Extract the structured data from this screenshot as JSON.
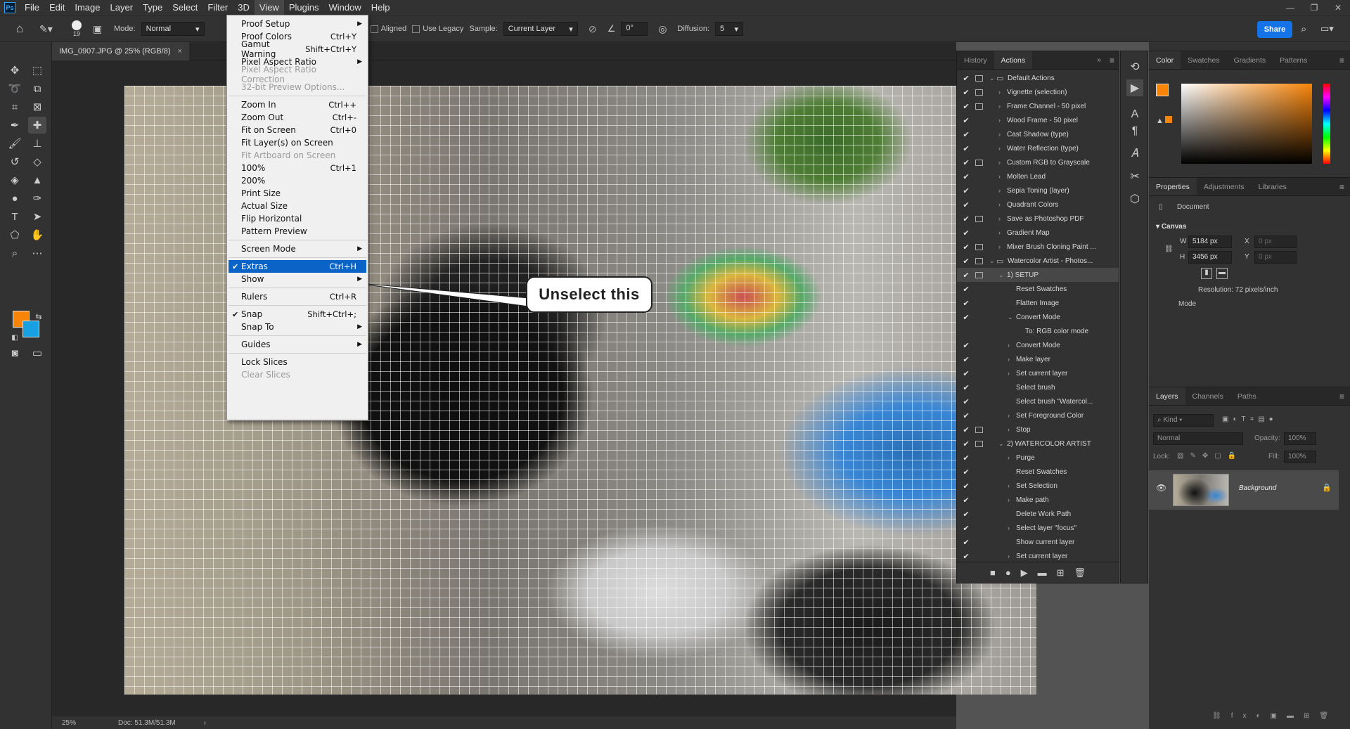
{
  "app": {
    "logo": "Ps"
  },
  "menubar": [
    "File",
    "Edit",
    "Image",
    "Layer",
    "Type",
    "Select",
    "Filter",
    "3D",
    "View",
    "Plugins",
    "Window",
    "Help"
  ],
  "options": {
    "brush_size": "19",
    "mode_label": "Mode:",
    "mode_value": "Normal",
    "aligned": "Aligned",
    "use_legacy": "Use Legacy",
    "sample_label": "Sample:",
    "sample_value": "Current Layer",
    "angle": "0°",
    "diffusion_label": "Diffusion:",
    "diffusion_value": "5",
    "share": "Share"
  },
  "document": {
    "tab_title": "IMG_0907.JPG @ 25% (RGB/8)",
    "close": "×"
  },
  "status": {
    "zoom": "25%",
    "doc": "Doc: 51.3M/51.3M"
  },
  "callout": "Unselect this",
  "view_menu": [
    {
      "label": "Proof Setup",
      "shortcut": "",
      "arrow": true
    },
    {
      "label": "Proof Colors",
      "shortcut": "Ctrl+Y"
    },
    {
      "label": "Gamut Warning",
      "shortcut": "Shift+Ctrl+Y"
    },
    {
      "label": "Pixel Aspect Ratio",
      "shortcut": "",
      "arrow": true
    },
    {
      "label": "Pixel Aspect Ratio Correction",
      "shortcut": "",
      "disabled": true
    },
    {
      "label": "32-bit Preview Options...",
      "shortcut": "",
      "disabled": true
    },
    {
      "sep": true
    },
    {
      "label": "Zoom In",
      "shortcut": "Ctrl++"
    },
    {
      "label": "Zoom Out",
      "shortcut": "Ctrl+-"
    },
    {
      "label": "Fit on Screen",
      "shortcut": "Ctrl+0"
    },
    {
      "label": "Fit Layer(s) on Screen",
      "shortcut": ""
    },
    {
      "label": "Fit Artboard on Screen",
      "shortcut": "",
      "disabled": true
    },
    {
      "label": "100%",
      "shortcut": "Ctrl+1"
    },
    {
      "label": "200%",
      "shortcut": ""
    },
    {
      "label": "Print Size",
      "shortcut": ""
    },
    {
      "label": "Actual Size",
      "shortcut": ""
    },
    {
      "label": "Flip Horizontal",
      "shortcut": ""
    },
    {
      "label": "Pattern Preview",
      "shortcut": ""
    },
    {
      "sep": true
    },
    {
      "label": "Screen Mode",
      "shortcut": "",
      "arrow": true
    },
    {
      "sep": true
    },
    {
      "label": "Extras",
      "shortcut": "Ctrl+H",
      "checked": true,
      "highlight": true
    },
    {
      "label": "Show",
      "shortcut": "",
      "arrow": true
    },
    {
      "sep": true
    },
    {
      "label": "Rulers",
      "shortcut": "Ctrl+R"
    },
    {
      "sep": true
    },
    {
      "label": "Snap",
      "shortcut": "Shift+Ctrl+;",
      "checked": true
    },
    {
      "label": "Snap To",
      "shortcut": "",
      "arrow": true
    },
    {
      "sep": true
    },
    {
      "label": "Guides",
      "shortcut": "",
      "arrow": true
    },
    {
      "sep": true
    },
    {
      "label": "Lock Slices",
      "shortcut": ""
    },
    {
      "label": "Clear Slices",
      "shortcut": "",
      "disabled": true
    }
  ],
  "actions_panel": {
    "tabs": [
      "History",
      "Actions"
    ],
    "rows": [
      {
        "name": "Default Actions",
        "level": 0,
        "folder": true,
        "open": true,
        "dlg": true
      },
      {
        "name": "Vignette (selection)",
        "level": 1,
        "dlg": true
      },
      {
        "name": "Frame Channel - 50 pixel",
        "level": 1,
        "dlg": true
      },
      {
        "name": "Wood Frame - 50 pixel",
        "level": 1,
        "dlg": false
      },
      {
        "name": "Cast Shadow (type)",
        "level": 1,
        "dlg": false
      },
      {
        "name": "Water Reflection (type)",
        "level": 1,
        "dlg": false
      },
      {
        "name": "Custom RGB to Grayscale",
        "level": 1,
        "dlg": true
      },
      {
        "name": "Molten Lead",
        "level": 1,
        "dlg": false
      },
      {
        "name": "Sepia Toning (layer)",
        "level": 1,
        "dlg": false
      },
      {
        "name": "Quadrant Colors",
        "level": 1,
        "dlg": false
      },
      {
        "name": "Save as Photoshop PDF",
        "level": 1,
        "dlg": true
      },
      {
        "name": "Gradient Map",
        "level": 1,
        "dlg": false
      },
      {
        "name": "Mixer Brush Cloning Paint ...",
        "level": 1,
        "dlg": true
      },
      {
        "name": "Watercolor Artist - Photos...",
        "level": 0,
        "folder": true,
        "open": true,
        "dlg": true
      },
      {
        "name": "1) SETUP",
        "level": 1,
        "open": true,
        "dlg": true,
        "selected": true
      },
      {
        "name": "Reset Swatches",
        "level": 2,
        "dlg": false
      },
      {
        "name": "Flatten Image",
        "level": 2,
        "dlg": false
      },
      {
        "name": "Convert Mode",
        "level": 2,
        "open": true,
        "dlg": false
      },
      {
        "name": "To: RGB color mode",
        "level": 3,
        "nocheck": true
      },
      {
        "name": "Convert Mode",
        "level": 2,
        "closed": true,
        "dlg": false
      },
      {
        "name": "Make layer",
        "level": 2,
        "closed": true,
        "dlg": false
      },
      {
        "name": "Set current layer",
        "level": 2,
        "closed": true,
        "dlg": false
      },
      {
        "name": "Select brush",
        "level": 2,
        "dlg": false
      },
      {
        "name": "Select brush \"Watercol...",
        "level": 2,
        "dlg": false
      },
      {
        "name": "Set Foreground Color",
        "level": 2,
        "closed": true,
        "dlg": false
      },
      {
        "name": "Stop",
        "level": 2,
        "closed": true,
        "dlg": true
      },
      {
        "name": "2) WATERCOLOR ARTIST",
        "level": 1,
        "open": true,
        "dlg": true
      },
      {
        "name": "Purge",
        "level": 2,
        "closed": true,
        "dlg": false
      },
      {
        "name": "Reset Swatches",
        "level": 2,
        "dlg": false
      },
      {
        "name": "Set Selection",
        "level": 2,
        "closed": true,
        "dlg": false
      },
      {
        "name": "Make path",
        "level": 2,
        "closed": true,
        "dlg": false
      },
      {
        "name": "Delete Work Path",
        "level": 2,
        "dlg": false
      },
      {
        "name": "Select layer \"focus\"",
        "level": 2,
        "closed": true,
        "dlg": false
      },
      {
        "name": "Show current layer",
        "level": 2,
        "dlg": false
      },
      {
        "name": "Set current layer",
        "level": 2,
        "closed": true,
        "dlg": false
      }
    ]
  },
  "color_panel": {
    "tabs": [
      "Color",
      "Swatches",
      "Gradients",
      "Patterns"
    ],
    "foreground": "#f88408",
    "background": "#18a0e3"
  },
  "properties": {
    "tabs": [
      "Properties",
      "Adjustments",
      "Libraries"
    ],
    "type": "Document",
    "section": "Canvas",
    "w_label": "W",
    "w": "5184 px",
    "h_label": "H",
    "h": "3456 px",
    "x_label": "X",
    "x": "0 px",
    "y_label": "Y",
    "y": "0 px",
    "resolution": "Resolution: 72 pixels/inch",
    "mode": "Mode"
  },
  "layers": {
    "tabs": [
      "Layers",
      "Channels",
      "Paths"
    ],
    "kind": "Kind",
    "blend": "Normal",
    "opacity_label": "Opacity:",
    "opacity": "100%",
    "lock_label": "Lock:",
    "fill_label": "Fill:",
    "fill": "100%",
    "layer_name": "Background"
  },
  "colors": {
    "accent": "#1473e6",
    "menu_highlight": "#0a64c8"
  }
}
